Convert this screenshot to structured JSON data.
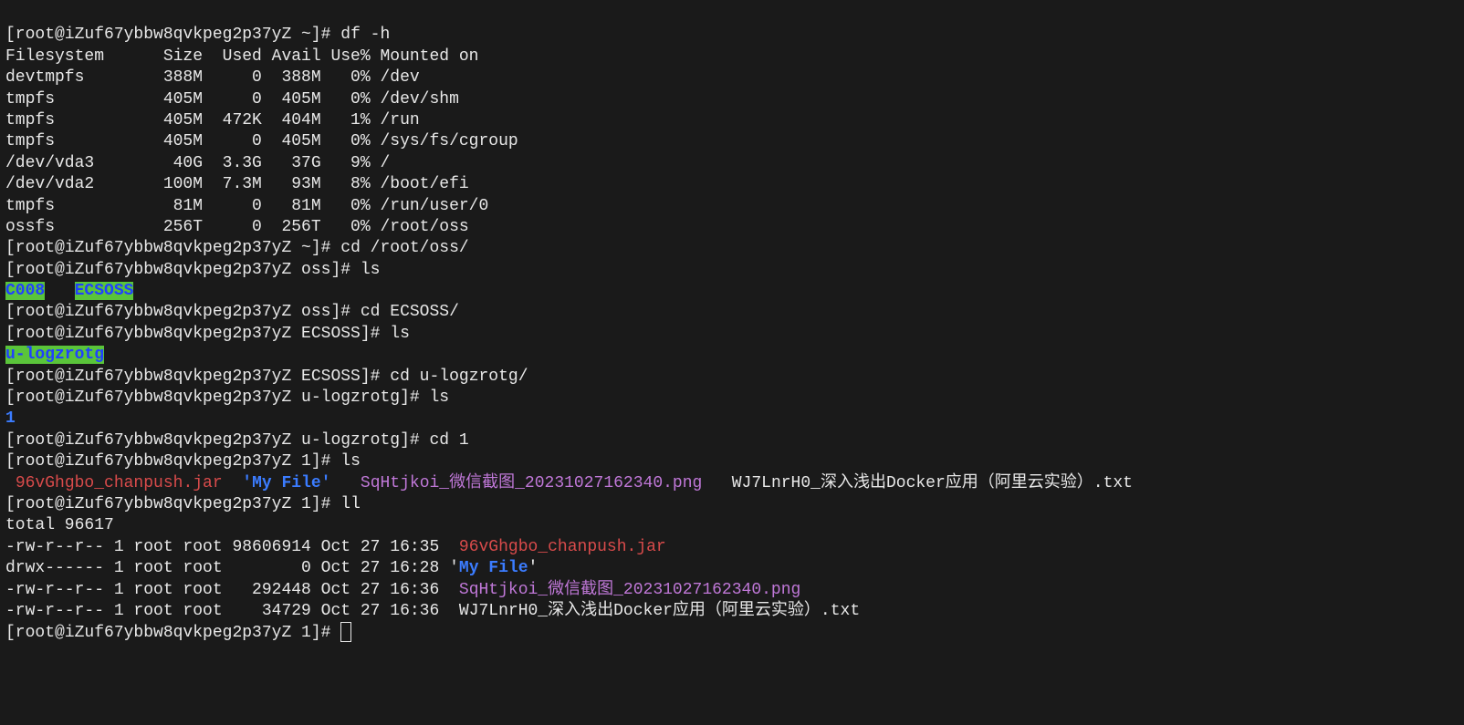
{
  "host": "iZuf67ybbw8qvkpeg2p37yZ",
  "prompts": {
    "home": "[root@iZuf67ybbw8qvkpeg2p37yZ ~]# ",
    "oss": "[root@iZuf67ybbw8qvkpeg2p37yZ oss]# ",
    "ecsoss": "[root@iZuf67ybbw8qvkpeg2p37yZ ECSOSS]# ",
    "ulog": "[root@iZuf67ybbw8qvkpeg2p37yZ u-logzrotg]# ",
    "one": "[root@iZuf67ybbw8qvkpeg2p37yZ 1]# "
  },
  "cmds": {
    "dfh": "df -h",
    "cd_oss": "cd /root/oss/",
    "ls": "ls",
    "cd_ecsoss": "cd ECSOSS/",
    "cd_ulog": "cd u-logzrotg/",
    "cd_1": "cd 1",
    "ll": "ll"
  },
  "df": {
    "header": "Filesystem      Size  Used Avail Use% Mounted on",
    "rows": [
      "devtmpfs        388M     0  388M   0% /dev",
      "tmpfs           405M     0  405M   0% /dev/shm",
      "tmpfs           405M  472K  404M   1% /run",
      "tmpfs           405M     0  405M   0% /sys/fs/cgroup",
      "/dev/vda3        40G  3.3G   37G   9% /",
      "/dev/vda2       100M  7.3M   93M   8% /boot/efi",
      "tmpfs            81M     0   81M   0% /run/user/0",
      "ossfs           256T     0  256T   0% /root/oss"
    ]
  },
  "ls_oss": {
    "c008": "C008",
    "gap": "   ",
    "ecsoss": "ECSOSS"
  },
  "ls_ecsoss": {
    "ulog": "u-logzrotg"
  },
  "ls_ulog": {
    "one": "1"
  },
  "ls_1": {
    "jar_pre": " ",
    "jar": "96vGhgbo_chanpush.jar",
    "gap1": "  ",
    "myfile_quoted": "'My File'",
    "gap2": "   ",
    "png": "SqHtjkoi_微信截图_20231027162340.png",
    "gap3": "   ",
    "txt": "WJ7LnrH0_深入浅出Docker应用（阿里云实验）.txt"
  },
  "ll": {
    "total": "total 96617",
    "rows": [
      {
        "meta": "-rw-r--r-- 1 root root 98606914 Oct 27 16:35  ",
        "name": "96vGhgbo_chanpush.jar",
        "cls": "red"
      },
      {
        "meta": "drwx------ 1 root root        0 Oct 27 16:28 ",
        "q1": "'",
        "name": "My File",
        "q2": "'",
        "cls": "blue"
      },
      {
        "meta": "-rw-r--r-- 1 root root   292448 Oct 27 16:36  ",
        "name": "SqHtjkoi_微信截图_20231027162340.png",
        "cls": "magenta"
      },
      {
        "meta": "-rw-r--r-- 1 root root    34729 Oct 27 16:36  ",
        "name": "WJ7LnrH0_深入浅出Docker应用（阿里云实验）.txt",
        "cls": ""
      }
    ]
  }
}
